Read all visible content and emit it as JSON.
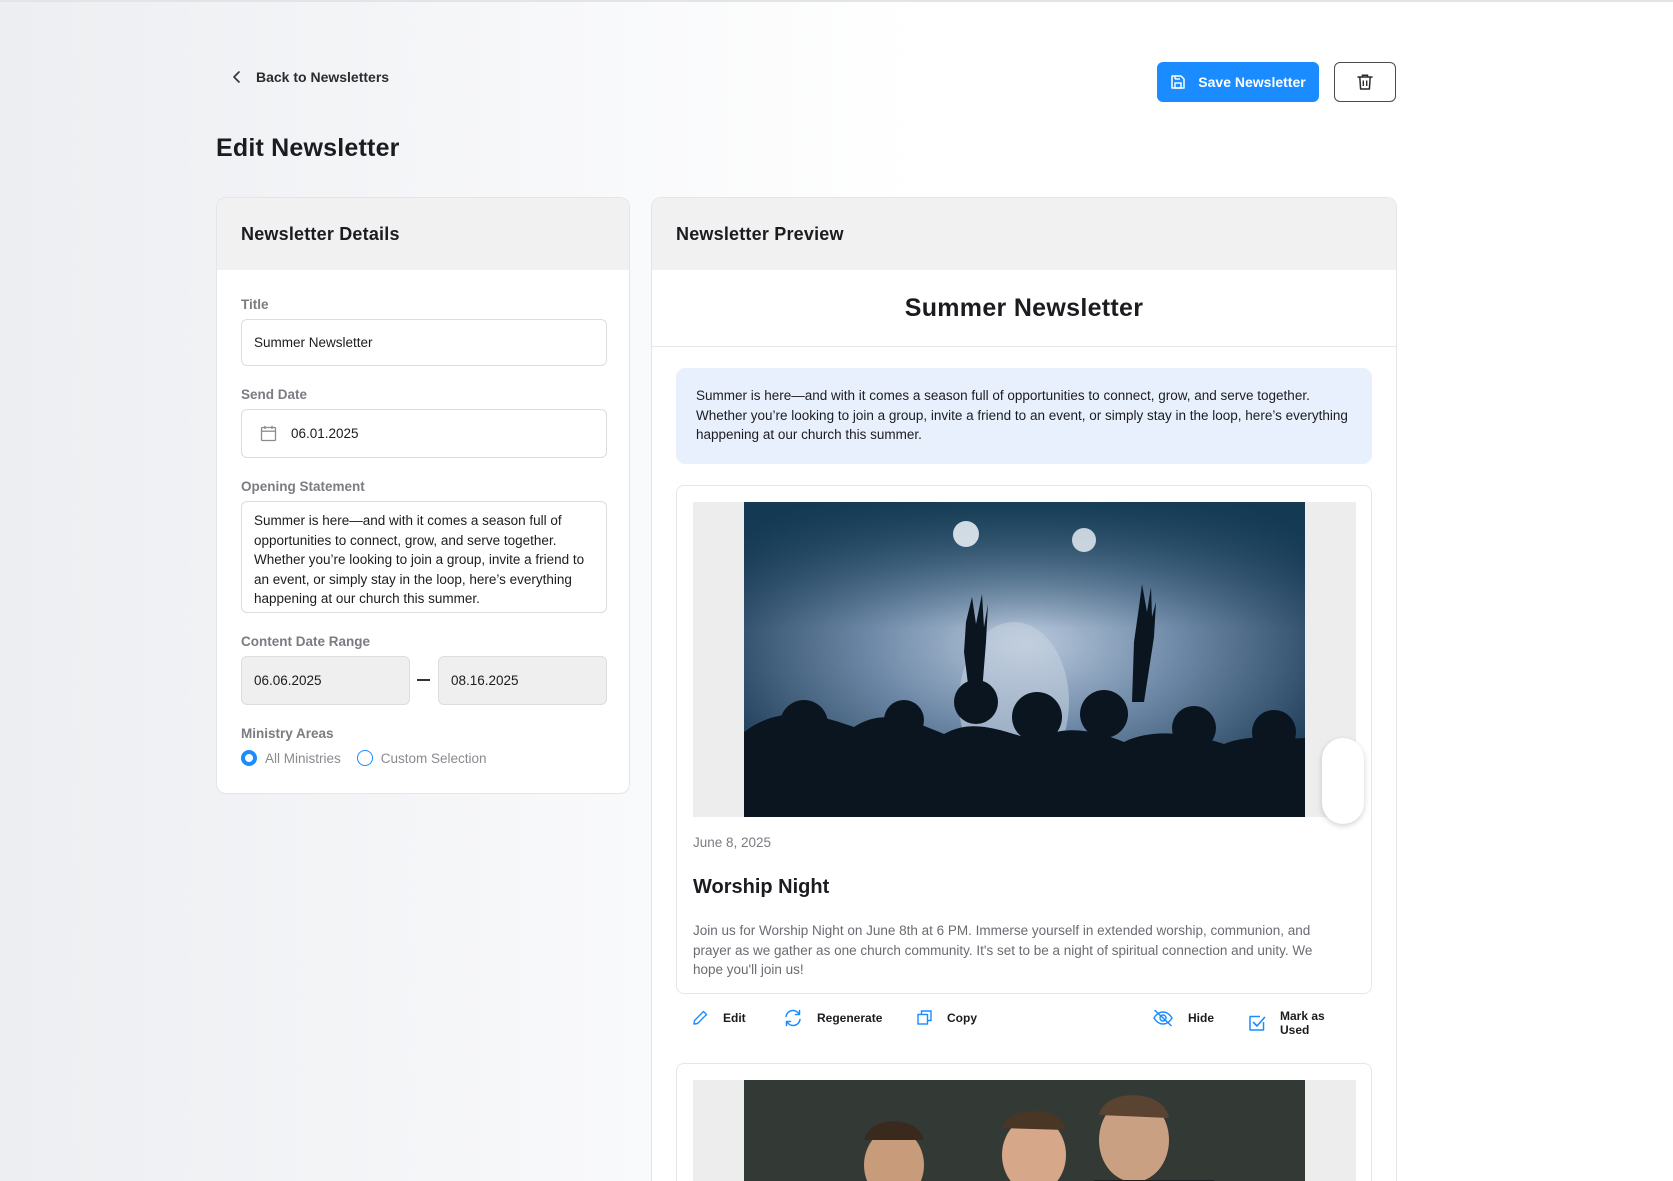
{
  "header": {
    "back_label": "Back to Newsletters",
    "save_label": "Save Newsletter",
    "page_title": "Edit Newsletter"
  },
  "details": {
    "heading": "Newsletter Details",
    "title_label": "Title",
    "title_value": "Summer Newsletter",
    "send_date_label": "Send Date",
    "send_date_value": "06.01.2025",
    "opening_label": "Opening Statement",
    "opening_value": "Summer is here—and with it comes a season full of opportunities to connect, grow, and serve together. Whether you’re looking to join a group, invite a friend to an event, or simply stay in the loop, here’s everything happening at our church this summer.",
    "range_label": "Content Date Range",
    "range_start": "06.06.2025",
    "range_end": "08.16.2025",
    "ministry_label": "Ministry Areas",
    "ministry_options": [
      {
        "label": "All Ministries",
        "selected": true
      },
      {
        "label": "Custom Selection",
        "selected": false
      }
    ]
  },
  "preview": {
    "heading": "Newsletter Preview",
    "title": "Summer Newsletter",
    "intro": "Summer is here—and with it comes a season full of opportunities to connect, grow, and serve together. Whether you’re looking to join a group, invite a friend to an event, or simply stay in the loop, here’s everything happening at our church this summer.",
    "cards": [
      {
        "date": "June 8, 2025",
        "title": "Worship Night",
        "description": "Join us for Worship Night on June 8th at 6 PM. Immerse yourself in extended worship, communion, and prayer as we gather as one church community. It's set to be a night of spiritual connection and unity. We hope you'll join us!",
        "image_icon": "concert-photo"
      },
      {
        "image_icon": "people-photo"
      }
    ],
    "actions": {
      "edit": "Edit",
      "regenerate": "Regenerate",
      "copy": "Copy",
      "hide": "Hide",
      "mark_used": "Mark as Used"
    }
  },
  "colors": {
    "accent": "#1a8cff",
    "intro_bg": "#e8f0fd",
    "panel_head_bg": "#f1f1f2"
  }
}
